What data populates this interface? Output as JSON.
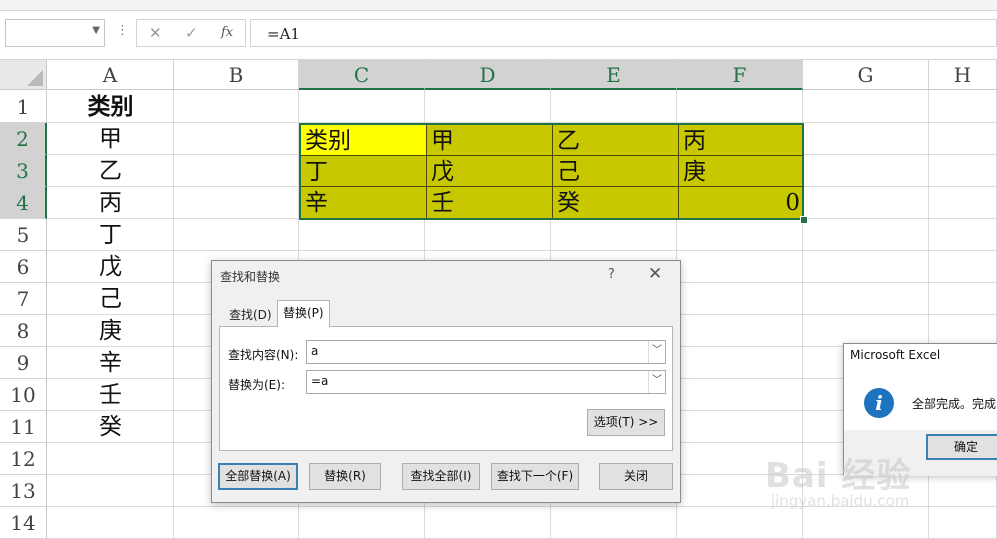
{
  "formula_bar": {
    "name_box": "",
    "cancel_icon": "✕",
    "enter_icon": "✓",
    "fx_label": "fx",
    "formula": "=A1"
  },
  "columns": [
    "A",
    "B",
    "C",
    "D",
    "E",
    "F",
    "G",
    "H"
  ],
  "selected_columns": [
    "C",
    "D",
    "E",
    "F"
  ],
  "rows": [
    "1",
    "2",
    "3",
    "4",
    "5",
    "6",
    "7",
    "8",
    "9",
    "10",
    "11",
    "12",
    "13",
    "14"
  ],
  "selected_rows": [
    "2",
    "3",
    "4"
  ],
  "column_a": [
    "类别",
    "甲",
    "乙",
    "丙",
    "丁",
    "戊",
    "己",
    "庚",
    "辛",
    "壬",
    "癸"
  ],
  "range_cells": [
    [
      "类别",
      "甲",
      "乙",
      "丙"
    ],
    [
      "丁",
      "戊",
      "己",
      "庚"
    ],
    [
      "辛",
      "壬",
      "癸",
      "0"
    ]
  ],
  "colors": {
    "range_fill": "#c8c800",
    "highlight_cell": "#ffff00",
    "excel_green": "#217346",
    "info_blue": "#1e73be"
  },
  "find_replace": {
    "title": "查找和替换",
    "help": "?",
    "close": "✕",
    "tabs": [
      {
        "label": "查找(D)",
        "active": false
      },
      {
        "label": "替换(P)",
        "active": true
      }
    ],
    "find_label": "查找内容(N):",
    "find_value": "a",
    "replace_label": "替换为(E):",
    "replace_value": "=a",
    "options_button": "选项(T) >>",
    "buttons": {
      "replace_all": "全部替换(A)",
      "replace": "替换(R)",
      "find_all": "查找全部(I)",
      "find_next": "查找下一个(F)",
      "close": "关闭"
    }
  },
  "message_box": {
    "title": "Microsoft Excel",
    "text": "全部完成。完成",
    "ok": "确定"
  },
  "watermark": {
    "logo": "Bai 经验",
    "url": "jingyan.baidu.com"
  }
}
